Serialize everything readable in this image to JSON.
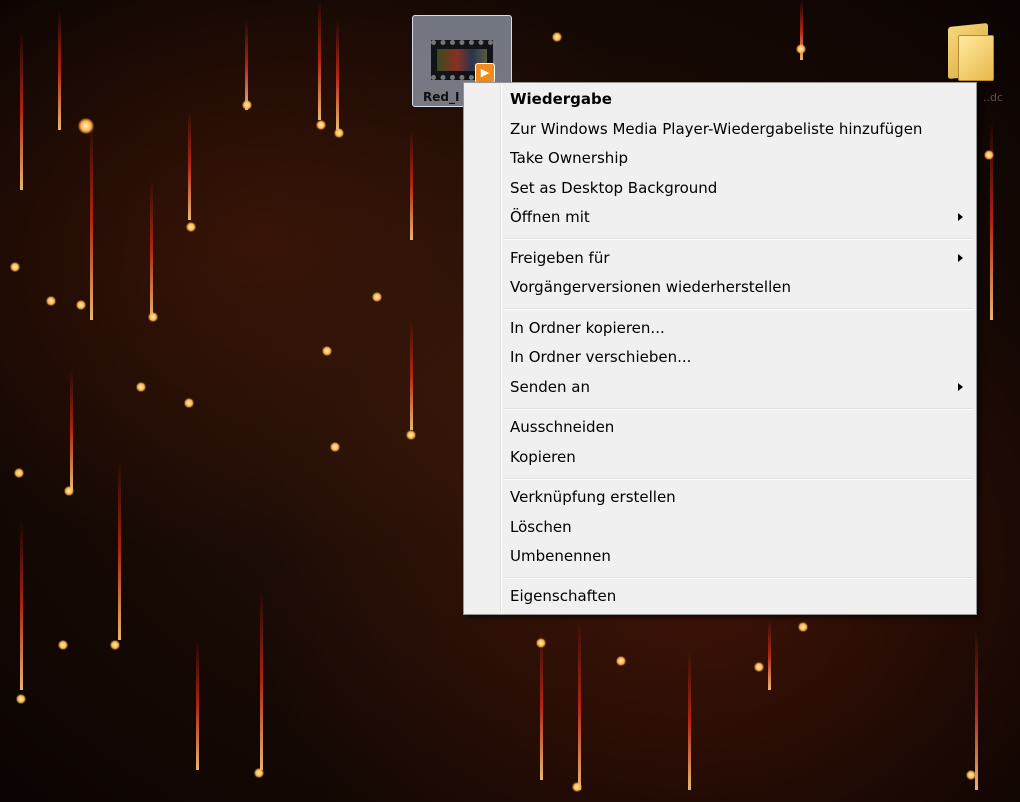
{
  "desktop": {
    "file_icon": {
      "label": "Red_I",
      "icon": "video-file-icon",
      "badge_icon": "play-badge-icon",
      "badge_glyph": "▶"
    },
    "folder_icon": {
      "label": "..dc",
      "icon": "folder-icon"
    }
  },
  "context_menu": {
    "items": [
      {
        "label": "Wiedergabe",
        "default": true
      },
      {
        "label": "Zur Windows Media Player-Wiedergabeliste hinzufügen"
      },
      {
        "label": "Take Ownership"
      },
      {
        "label": "Set as Desktop Background"
      },
      {
        "label": "Öffnen mit",
        "submenu": true
      },
      {
        "label": "Freigeben für",
        "submenu": true
      },
      {
        "label": "Vorgängerversionen wiederherstellen"
      },
      {
        "label": "In Ordner kopieren..."
      },
      {
        "label": "In Ordner verschieben..."
      },
      {
        "label": "Senden an",
        "submenu": true
      },
      {
        "label": "Ausschneiden"
      },
      {
        "label": "Kopieren"
      },
      {
        "label": "Verknüpfung erstellen"
      },
      {
        "label": "Löschen"
      },
      {
        "label": "Umbenennen"
      },
      {
        "label": "Eigenschaften"
      }
    ]
  },
  "colors": {
    "menu_background": "#f0f0f0",
    "menu_border": "#979797",
    "wallpaper_base": "#160904",
    "spark": "#ffb347"
  }
}
